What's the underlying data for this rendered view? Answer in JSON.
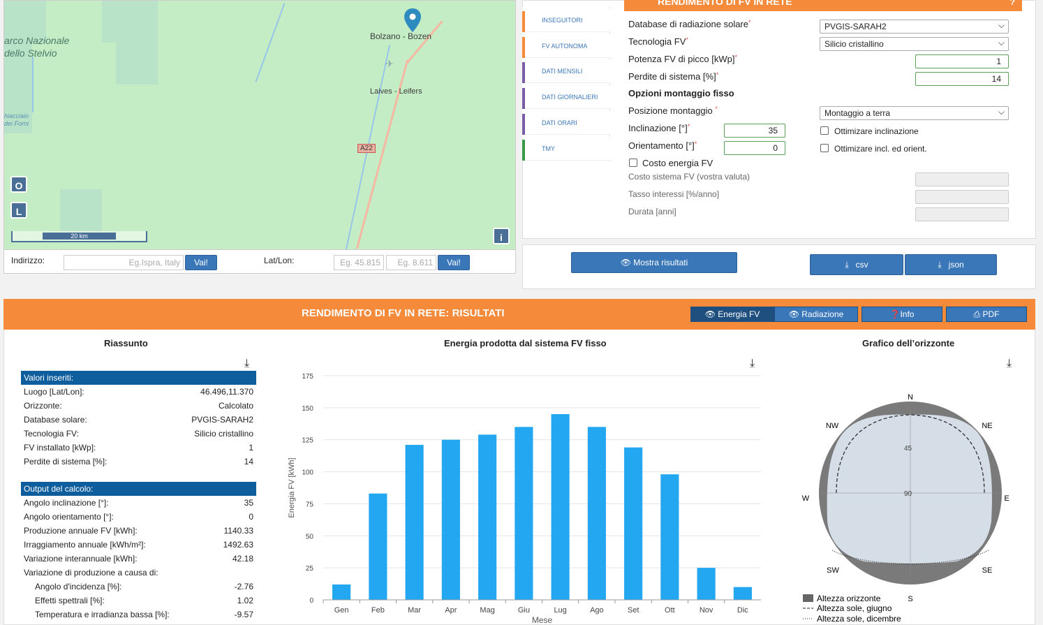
{
  "map": {
    "city": "Bolzano - Bozen",
    "town": "Laives - Leifers",
    "park_line1": "arco Nazionale",
    "park_line2": "dello Stelvio",
    "glacier_line1": "hiacciaio",
    "glacier_line2": "dei Forni",
    "road": "A22",
    "btn_o": "O",
    "btn_l": "L",
    "btn_info": "i",
    "scale": "20 km"
  },
  "address": {
    "label": "Indirizzo:",
    "placeholder": "Eg.Ispra, Italy",
    "go": "Vai!",
    "latlon_label": "Lat/Lon:",
    "lat_placeholder": "Eg. 45.815",
    "lon_placeholder": "Eg. 8.611",
    "go2": "Vai!"
  },
  "tabs": [
    {
      "label": "INSEGUITORI",
      "color": "#f58a3a"
    },
    {
      "label": "FV AUTONOMA",
      "color": "#f58a3a"
    },
    {
      "label": "DATI MENSILI",
      "color": "#7a5ca8"
    },
    {
      "label": "DATI GIORNALIERI",
      "color": "#7a5ca8"
    },
    {
      "label": "DATI ORARI",
      "color": "#7a5ca8"
    },
    {
      "label": "TMY",
      "color": "#3a9a4a"
    }
  ],
  "form": {
    "header": "RENDIMENTO DI FV IN RETE",
    "db_label": "Database di radiazione solare",
    "db_value": "PVGIS-SARAH2",
    "tech_label": "Tecnologia FV",
    "tech_value": "Silicio cristallino",
    "power_label": "Potenza FV di picco [kWp]",
    "power_value": "1",
    "loss_label": "Perdite di sistema [%]",
    "loss_value": "14",
    "mount_title": "Opzioni montaggio fisso",
    "pos_label": "Posizione montaggio",
    "pos_value": "Montaggio a terra",
    "incl_label": "Inclinazione [°]",
    "incl_value": "35",
    "orient_label": "Orientamento [°]",
    "orient_value": "0",
    "opt_incl": "Ottimizare inclinazione",
    "opt_both": "Ottimizare incl. ed orient.",
    "cost_label": "Costo energia FV",
    "cost_sys": "Costo sistema FV (vostra valuta)",
    "interest": "Tasso interessi [%/anno]",
    "duration": "Durata [anni]",
    "req": "*"
  },
  "buttons": {
    "show": "Mostra risultati",
    "csv": "csv",
    "json": "json"
  },
  "results": {
    "title": "RENDIMENTO DI FV IN RETE: RISULTATI",
    "btn_energy": "Energia FV",
    "btn_rad": "Radiazione",
    "btn_info": "Info",
    "btn_pdf": "PDF",
    "summary_title": "Riassunto",
    "chart_title": "Energia prodotta dal sistema FV fisso",
    "horizon_title": "Grafico dell’orizzonte",
    "inputs_header": "Valori inseriti:",
    "inputs": [
      {
        "k": "Luogo [Lat/Lon]:",
        "v": "46.496,11.370"
      },
      {
        "k": "Orizzonte:",
        "v": "Calcolato"
      },
      {
        "k": "Database solare:",
        "v": "PVGIS-SARAH2"
      },
      {
        "k": "Tecnologia FV:",
        "v": "Silicio cristallino"
      },
      {
        "k": "FV installato [kWp]:",
        "v": "1"
      },
      {
        "k": "Perdite di sistema [%]:",
        "v": "14"
      }
    ],
    "output_header": "Output del calcolo:",
    "outputs": [
      {
        "k": "Angolo inclinazione [°]:",
        "v": "35"
      },
      {
        "k": "Angolo orientamento [°]:",
        "v": "0"
      },
      {
        "k": "Produzione annuale FV [kWh]:",
        "v": "1140.33"
      },
      {
        "k": "Irraggiamento annuale [kWh/m²]:",
        "v": "1492.63"
      },
      {
        "k": "Variazione interannuale [kWh]:",
        "v": "42.18"
      },
      {
        "k": "Variazione di produzione a causa di:",
        "v": ""
      },
      {
        "k": "Angolo d'incidenza [%]:",
        "v": "-2.76"
      },
      {
        "k": "Effetti spettrali [%]:",
        "v": "1.02"
      },
      {
        "k": "Temperatura e irradianza bassa [%]:",
        "v": "-9.57"
      }
    ],
    "horizon": {
      "directions": [
        "N",
        "NE",
        "E",
        "SE",
        "S",
        "SW",
        "W",
        "NW"
      ],
      "rings": [
        "45",
        "90"
      ],
      "legend": [
        "Altezza orizzonte",
        "Altezza sole, giugno",
        "Altezza sole, dicembre"
      ]
    }
  },
  "chart_data": {
    "type": "bar",
    "title": "Energia prodotta dal sistema FV fisso",
    "xlabel": "Mese",
    "ylabel": "Energia FV [kWh]",
    "categories": [
      "Gen",
      "Feb",
      "Mar",
      "Apr",
      "Mag",
      "Giu",
      "Lug",
      "Ago",
      "Set",
      "Ott",
      "Nov",
      "Dic"
    ],
    "values": [
      12,
      83,
      121,
      125,
      129,
      135,
      145,
      135,
      119,
      98,
      25,
      10
    ],
    "ylim": [
      0,
      175
    ],
    "yticks": [
      0,
      25,
      50,
      75,
      100,
      125,
      150,
      175
    ],
    "color": "#22a7f0"
  }
}
